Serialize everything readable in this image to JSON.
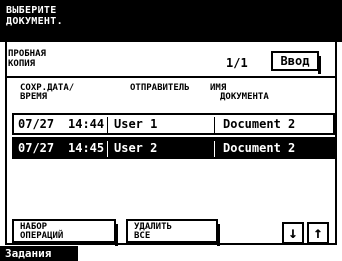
{
  "header": {
    "line1": "ВЫБЕРИТЕ",
    "line2": "ДОКУМЕНТ."
  },
  "mode": {
    "line1": "ПРОБНАЯ",
    "line2": "КОПИЯ"
  },
  "page_count": "1/1",
  "enter_label": "Ввод",
  "columns": {
    "date_line1": "СОХР.ДАТА/",
    "date_line2": "ВРЕМЯ",
    "sender": "ОТПРАВИТЕЛЬ",
    "docname_line1": "ИМЯ",
    "docname_line2": "ДОКУМЕНТА"
  },
  "rows": [
    {
      "date": "07/27",
      "time": "14:44",
      "sender": "User 1",
      "document": "Document 2",
      "selected": false
    },
    {
      "date": "07/27",
      "time": "14:45",
      "sender": "User 2",
      "document": "Document 2",
      "selected": true
    }
  ],
  "buttons": {
    "job_set_line1": "НАБОР",
    "job_set_line2": "ОПЕРАЦИЙ",
    "delete_all_line1": "УДАЛИТЬ",
    "delete_all_line2": "ВСЕ",
    "down_arrow": "↓",
    "up_arrow": "↑"
  },
  "footer": {
    "tab_label": "Задания"
  }
}
